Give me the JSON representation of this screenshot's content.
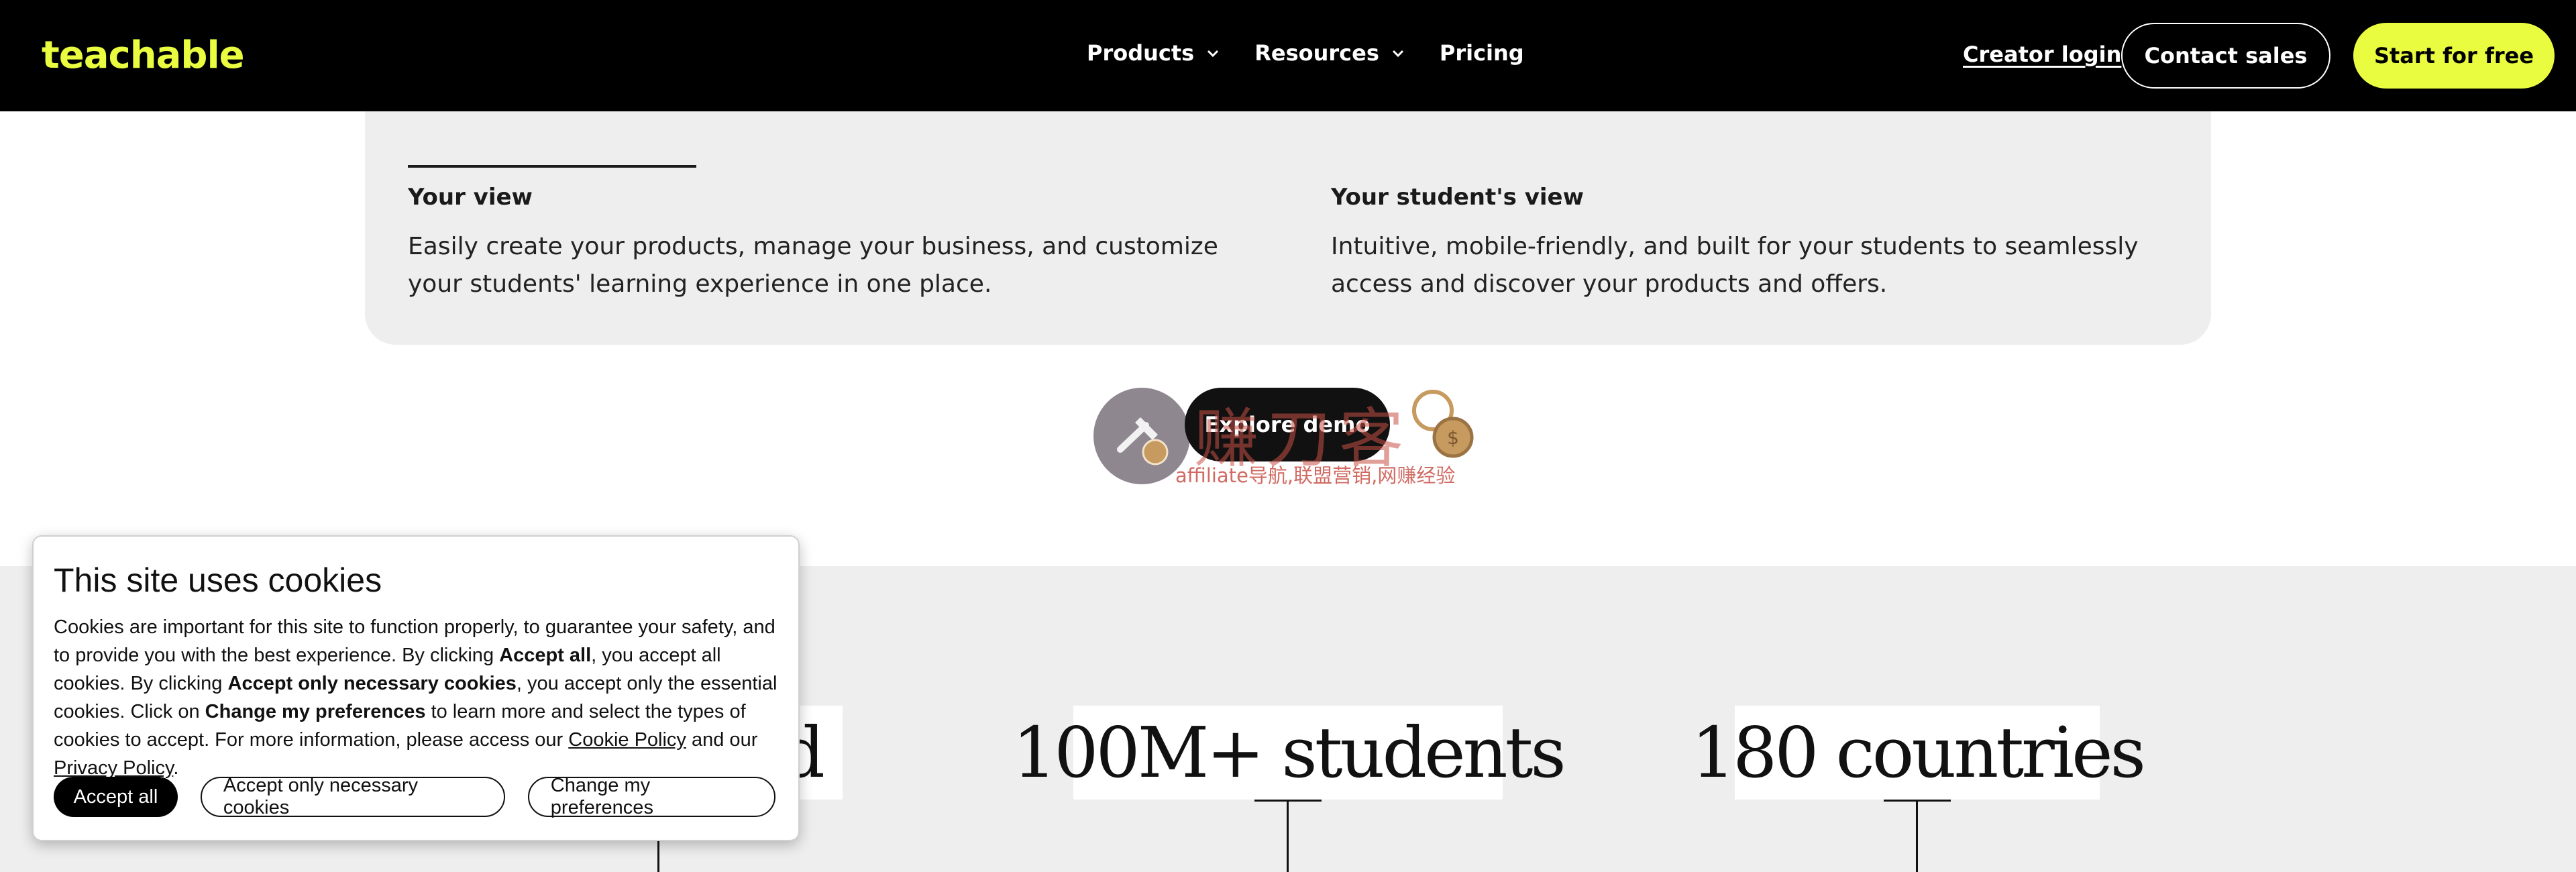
{
  "colors": {
    "brand_accent": "#e9fc3f",
    "header_bg": "#000000",
    "panel_bg": "#eeeeee"
  },
  "header": {
    "logo": "teachable",
    "nav": [
      {
        "label": "Products",
        "icon": "chevron-down-icon"
      },
      {
        "label": "Resources",
        "icon": "chevron-down-icon"
      },
      {
        "label": "Pricing"
      }
    ],
    "creator_login": "Creator login",
    "contact_sales": "Contact sales",
    "start_free": "Start for free"
  },
  "views": {
    "left": {
      "title": "Your view",
      "description": "Easily create your products, manage your business, and customize your students' learning experience in one place."
    },
    "right": {
      "title": "Your student's view",
      "description": "Intuitive, mobile-friendly, and built for your students to seamlessly access and discover your products and offers."
    }
  },
  "explore_demo": "Explore demo",
  "watermark": {
    "big": "赚刀客",
    "sub": "affiliate导航,联盟营销,网赚经验"
  },
  "stats": [
    {
      "label": "d"
    },
    {
      "label": "100M+ students"
    },
    {
      "label": "180 countries"
    }
  ],
  "cookie": {
    "title": "This site uses cookies",
    "p1": "Cookies are important for this site to function properly, to guarantee your safety, and to provide you with the best experience. By clicking ",
    "b1": "Accept all",
    "p2": ", you accept all cookies. By clicking ",
    "b2": "Accept only necessary cookies",
    "p3": ", you accept only the essential cookies. Click on ",
    "b3": "Change my preferences",
    "p4": " to learn more and select the types of cookies to accept. For more information, please access our ",
    "link1": "Cookie Policy",
    "p5": " and our ",
    "link2": "Privacy Policy",
    "p6": ".",
    "accept_all": "Accept all",
    "accept_necessary": "Accept only necessary cookies",
    "change_prefs": "Change my preferences"
  }
}
